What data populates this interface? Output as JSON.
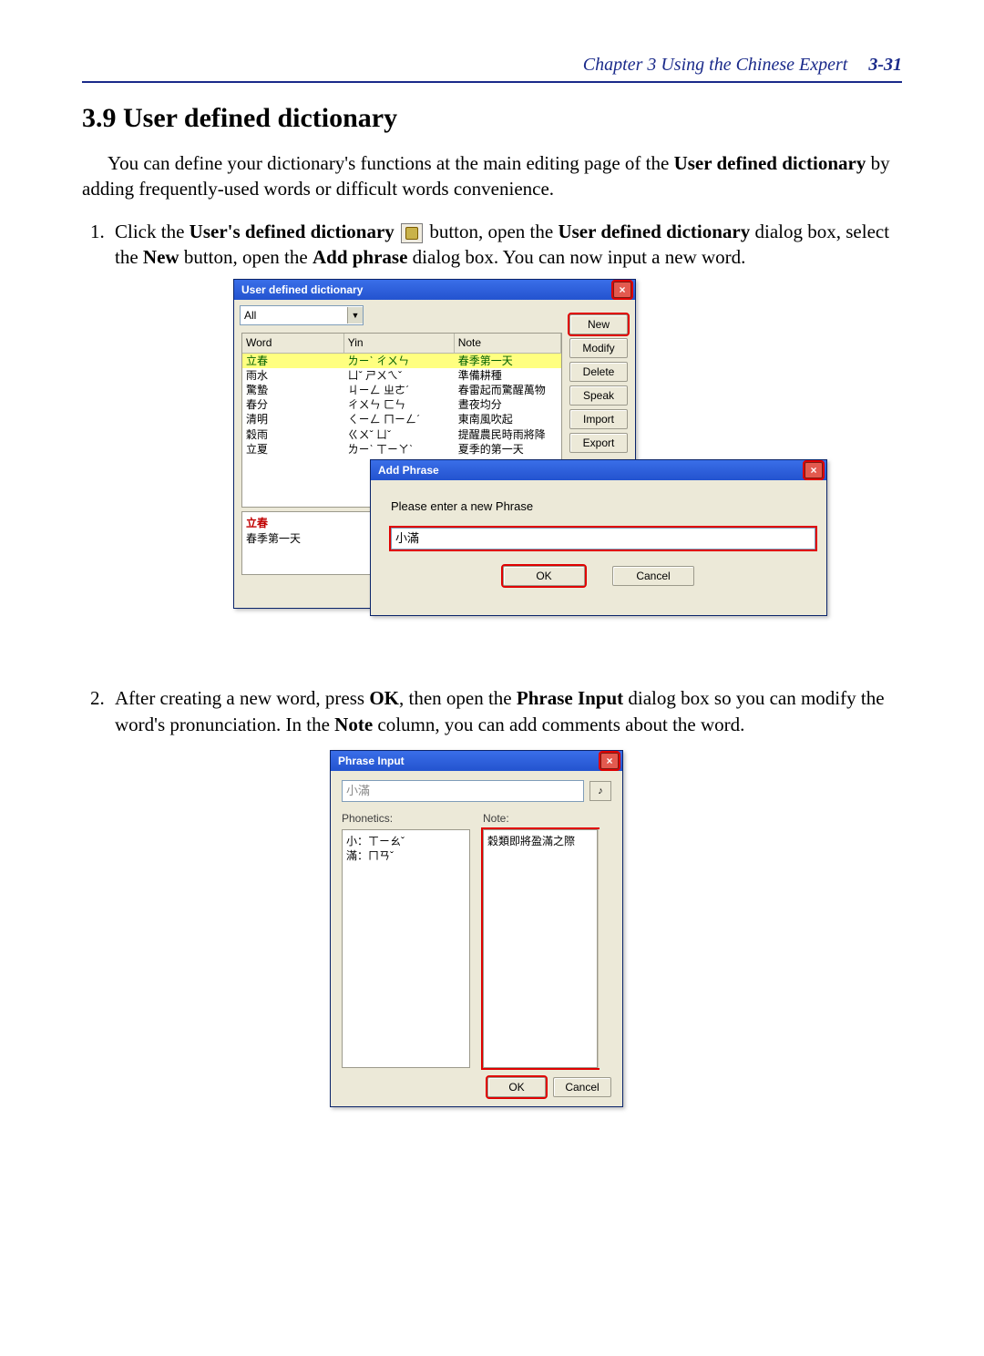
{
  "header": {
    "chapter_title": "Chapter 3  Using the Chinese Expert",
    "page_number": "3-31"
  },
  "section": {
    "number_title": "3.9  User defined dictionary"
  },
  "para1": {
    "t1": "You can define your dictionary's functions at the main editing page of the ",
    "b1": "User defined dictionary",
    "t2": " by adding frequently-used words or difficult words convenience."
  },
  "step1": {
    "t1": "Click the ",
    "b1": "User's defined dictionary",
    "t2": " button, open the ",
    "b2": "User defined dictionary",
    "t3": " dialog box, select the  ",
    "b3": "New",
    "t4": " button, open the ",
    "b4": "Add phrase",
    "t5": " dialog box. You can now input a new word."
  },
  "step2": {
    "t1": "After creating a new word, press ",
    "b1": "OK",
    "t2": ", then open the ",
    "b2": "Phrase Input",
    "t3": " dialog box so you can modify the word's pronunciation. In the ",
    "b3": "Note",
    "t4": " column, you can add comments about the word."
  },
  "dlg1": {
    "title": "User defined dictionary",
    "filter": "All",
    "columns": {
      "word": "Word",
      "yin": "Yin",
      "note": "Note"
    },
    "rows": [
      {
        "word": "立春",
        "yin": "ㄌㄧˋ ㄔㄨㄣ",
        "note": "春季第一天"
      },
      {
        "word": "雨水",
        "yin": "ㄩˇ ㄕㄨㄟˇ",
        "note": "準備耕種"
      },
      {
        "word": "驚蟄",
        "yin": "ㄐㄧㄥ ㄓㄜˊ",
        "note": "春雷起而驚醒萬物"
      },
      {
        "word": "春分",
        "yin": "ㄔㄨㄣ ㄈㄣ",
        "note": "晝夜均分"
      },
      {
        "word": "清明",
        "yin": "ㄑㄧㄥ ㄇㄧㄥˊ",
        "note": "東南風吹起"
      },
      {
        "word": "穀雨",
        "yin": "ㄍㄨˇ ㄩˇ",
        "note": "提醒農民時雨將降"
      },
      {
        "word": "立夏",
        "yin": "ㄌㄧˋ ㄒㄧㄚˋ",
        "note": "夏季的第一天"
      }
    ],
    "preview_word": "立春",
    "preview_note": "春季第一天",
    "buttons": {
      "new": "New",
      "modify": "Modify",
      "delete": "Delete",
      "speak": "Speak",
      "import": "Import",
      "export": "Export"
    }
  },
  "dlg2": {
    "title": "Add Phrase",
    "prompt": "Please enter a new Phrase",
    "value": "小滿",
    "ok": "OK",
    "cancel": "Cancel"
  },
  "dlg3": {
    "title": "Phrase Input",
    "value": "小滿",
    "phonetics_label": "Phonetics:",
    "note_label": "Note:",
    "phonetics_1": "小：ㄒㄧㄠˇ",
    "phonetics_2": "滿：ㄇㄢˇ",
    "note_value": "穀類即將盈滿之際",
    "ok": "OK",
    "cancel": "Cancel"
  }
}
